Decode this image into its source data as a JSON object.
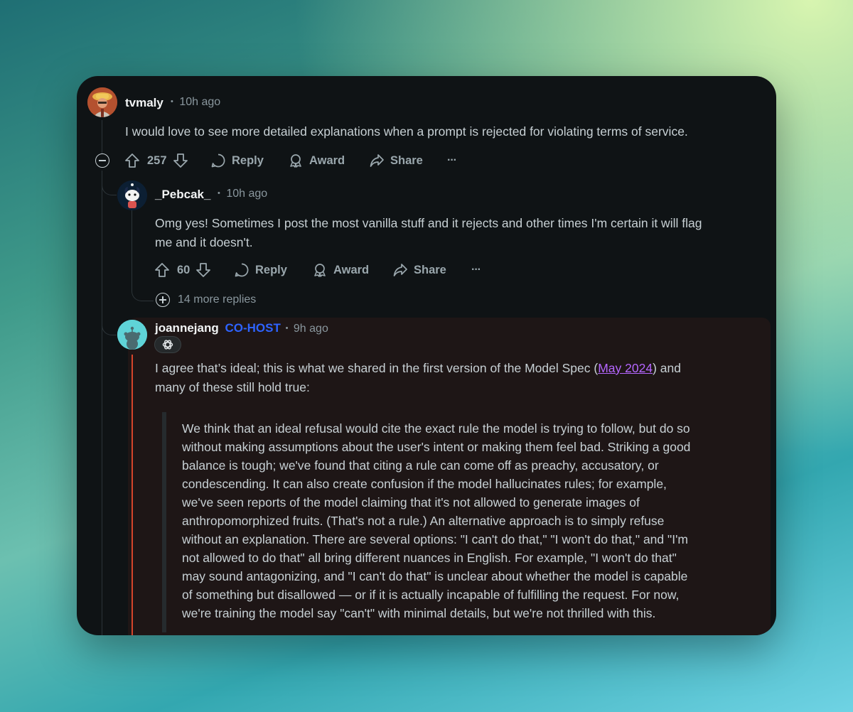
{
  "comments": [
    {
      "username": "tvmaly",
      "time": "10h ago",
      "body": "I would love to see more detailed explanations when a prompt is rejected for violating terms of service.",
      "votes": "257",
      "reply_label": "Reply",
      "award_label": "Award",
      "share_label": "Share",
      "more_label": "···"
    },
    {
      "username": "_Pebcak_",
      "time": "10h ago",
      "body_line1": "Omg yes! Sometimes I post the most vanilla stuff and it rejects and other times I'm certain it will flag",
      "body_line2": "me and it doesn't.",
      "votes": "60",
      "reply_label": "Reply",
      "award_label": "Award",
      "share_label": "Share",
      "more_label": "···",
      "more_replies": "14 more replies"
    },
    {
      "username": "joannejang",
      "badge": "CO-HOST",
      "time": "9h ago",
      "body_pre": "I agree that’s ideal; this is what we shared in the first version of the Model Spec (",
      "link_text": "May 2024",
      "body_post": ") and",
      "body_line2": "many of these still hold true:",
      "quote_lines": [
        "We think that an ideal refusal would cite the exact rule the model is trying to follow, but do so",
        "without making assumptions about the user's intent or making them feel bad. Striking a good",
        "balance is tough; we've found that citing a rule can come off as preachy, accusatory, or",
        "condescending. It can also create confusion if the model hallucinates rules; for example,",
        "we've seen reports of the model claiming that it's not allowed to generate images of",
        "anthropomorphized fruits. (That's not a rule.) An alternative approach is to simply refuse",
        "without an explanation. There are several options: \"I can't do that,\" \"I won't do that,\" and \"I'm",
        "not allowed to do that\" all bring different nuances in English. For example, \"I won't do that\"",
        "may sound antagonizing, and \"I can't do that\" is unclear about whether the model is capable",
        "of something but disallowed — or if it is actually incapable of fulfilling the request. For now,",
        "we're training the model say \"can't\" with minimal details, but we're not thrilled with this."
      ]
    }
  ],
  "separator": "•",
  "colors": {
    "card_bg": "#0f1315",
    "highlight_bg": "#1e1616",
    "cohost": "#2e63ff",
    "link": "#b566ff",
    "accent_line": "#d6452b"
  },
  "icons": [
    "upvote-icon",
    "downvote-icon",
    "comment-icon",
    "award-icon",
    "share-icon",
    "more-icon",
    "collapse-icon",
    "expand-icon",
    "openai-flair-icon"
  ]
}
